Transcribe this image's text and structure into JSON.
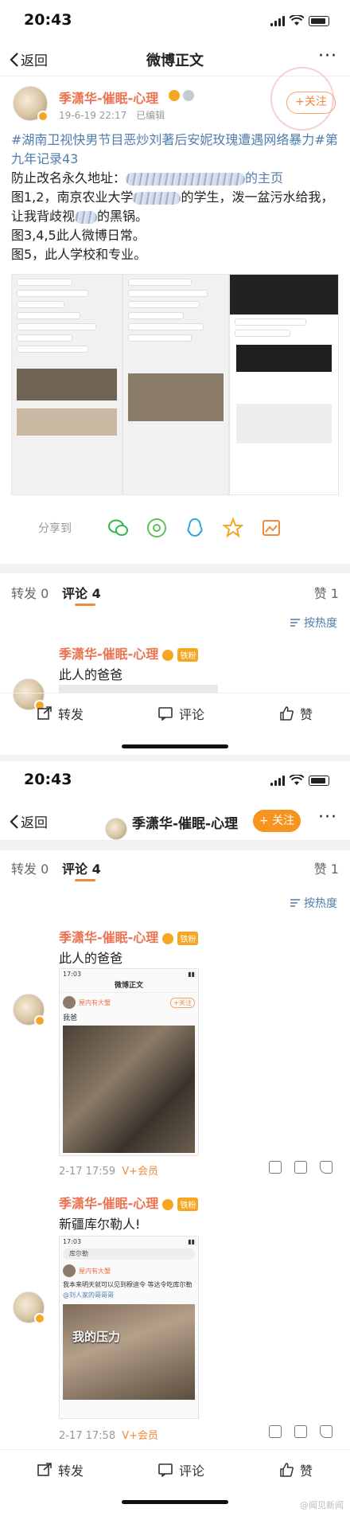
{
  "screen1": {
    "status": {
      "time": "20:43"
    },
    "nav": {
      "back_label": "返回",
      "title": "微博正文",
      "more": "···"
    },
    "author": {
      "name": "季潇华-催眠-心理",
      "date": "19-6-19 22:17",
      "edited": "已编辑",
      "follow_label": "+关注"
    },
    "post": {
      "topic": "#湖南卫视快男节目恶炒刘著后安妮玫瑰遭遇网络暴力#第九年记录43",
      "line1": "防止改名永久地址：",
      "line1_tail": "的主页",
      "line2": "图1,2，南京农业大学",
      "line2_tail": "的学生，泼一盆污水给我，让我背歧视",
      "line2_end": "的黑锅。",
      "line3": "图3,4,5此人微博日常。",
      "line4": "图5，此人学校和专业。"
    },
    "share": {
      "label": "分享到"
    },
    "tabs": {
      "repost": "转发 0",
      "comment": "评论 4",
      "like": "赞 1"
    },
    "sort_label": "按热度",
    "comment": {
      "name": "季潇华-催眠-心理",
      "badge": "铁粉",
      "text": "此人的爸爸"
    },
    "bottom": {
      "repost": "转发",
      "comment": "评论",
      "like": "赞"
    }
  },
  "screen2": {
    "status": {
      "time": "20:43"
    },
    "nav": {
      "back_label": "返回",
      "title": "季潇华-催眠-心理",
      "follow_label": "+ 关注",
      "more": "···"
    },
    "tabs": {
      "repost": "转发 0",
      "comment": "评论 4",
      "like": "赞 1"
    },
    "sort_label": "按热度",
    "comments": [
      {
        "name": "季潇华-催眠-心理",
        "badge": "铁粉",
        "text": "此人的爸爸",
        "card": {
          "time": "17:03",
          "title": "微博正文",
          "user": "屋内有大蟹",
          "follow": "+关注",
          "caption": "我爸"
        },
        "meta": "2-17 17:59",
        "vip": "V+会员"
      },
      {
        "name": "季潇华-催眠-心理",
        "badge": "铁粉",
        "text": "新疆库尔勒人!",
        "card": {
          "time": "17:03",
          "search": "库尔勒",
          "user": "屋内有大蟹",
          "body": "我本来明天就可以见到穆迪令 等达令吃库尔勒",
          "tag": "@刘人家的哥哥哥",
          "overlay": "我的压力"
        },
        "meta": "2-17 17:58",
        "vip": "V+会员"
      }
    ],
    "bottom": {
      "repost": "转发",
      "comment": "评论",
      "like": "赞"
    }
  },
  "watermark": "@闻见新闻",
  "colors": {
    "accent": "#f08a3c",
    "username": "#eb7350",
    "topic": "#507daf"
  }
}
